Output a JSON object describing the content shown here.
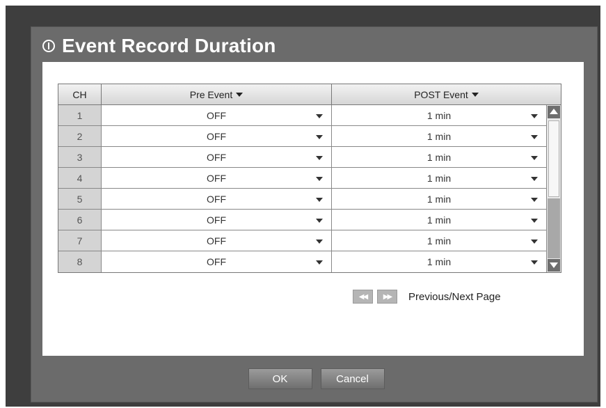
{
  "dialog": {
    "title": "Event Record Duration",
    "icon": "power-icon"
  },
  "table": {
    "columns": [
      "CH",
      "Pre Event",
      "POST Event"
    ],
    "rows": [
      {
        "ch": "1",
        "pre": "OFF",
        "post": "1 min"
      },
      {
        "ch": "2",
        "pre": "OFF",
        "post": "1 min"
      },
      {
        "ch": "3",
        "pre": "OFF",
        "post": "1 min"
      },
      {
        "ch": "4",
        "pre": "OFF",
        "post": "1 min"
      },
      {
        "ch": "5",
        "pre": "OFF",
        "post": "1 min"
      },
      {
        "ch": "6",
        "pre": "OFF",
        "post": "1 min"
      },
      {
        "ch": "7",
        "pre": "OFF",
        "post": "1 min"
      },
      {
        "ch": "8",
        "pre": "OFF",
        "post": "1 min"
      }
    ]
  },
  "pager": {
    "prev_icon": "rewind-icon",
    "next_icon": "fast-forward-icon",
    "label": "Previous/Next Page"
  },
  "buttons": {
    "ok": "OK",
    "cancel": "Cancel"
  },
  "colors": {
    "frame": "#3e3e3e",
    "dialog": "#6b6b6b",
    "content": "#ffffff"
  }
}
